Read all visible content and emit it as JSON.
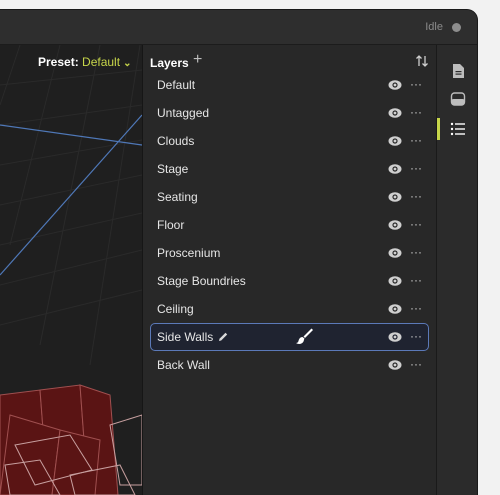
{
  "status": {
    "label": "Idle"
  },
  "viewport": {
    "preset_label": "Preset:",
    "preset_value": "Default",
    "chevron": "chevron-down-icon"
  },
  "layers": {
    "title": "Layers",
    "add_icon": "plus-icon",
    "sort_icon": "sort-icon",
    "items": [
      {
        "label": "Default",
        "visible": true,
        "selected": false
      },
      {
        "label": "Untagged",
        "visible": true,
        "selected": false
      },
      {
        "label": "Clouds",
        "visible": true,
        "selected": false
      },
      {
        "label": "Stage",
        "visible": true,
        "selected": false
      },
      {
        "label": "Seating",
        "visible": true,
        "selected": false
      },
      {
        "label": "Floor",
        "visible": true,
        "selected": false
      },
      {
        "label": "Proscenium",
        "visible": true,
        "selected": false
      },
      {
        "label": "Stage Boundries",
        "visible": true,
        "selected": false
      },
      {
        "label": "Ceiling",
        "visible": true,
        "selected": false
      },
      {
        "label": "Side Walls",
        "visible": true,
        "selected": true
      },
      {
        "label": "Back Wall",
        "visible": true,
        "selected": false
      }
    ],
    "more_glyph": "···"
  },
  "sidebar": {
    "icons": [
      "document-icon",
      "objects-icon",
      "layers-list-icon"
    ],
    "active": "layers-list-icon"
  },
  "colors": {
    "accent": "#c7d64a",
    "selection_border": "#5b79b8",
    "model_fill": "#5a1414"
  }
}
